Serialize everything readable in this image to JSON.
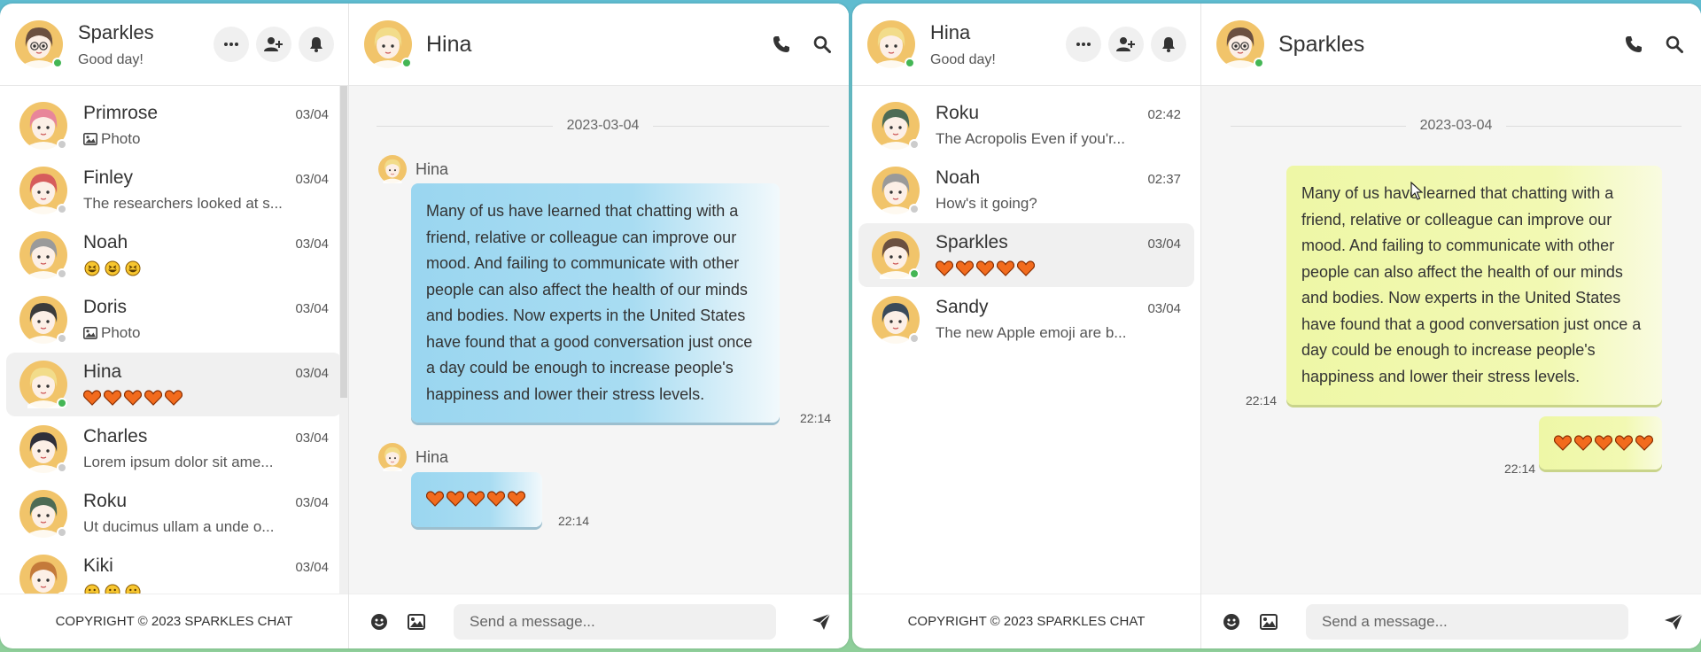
{
  "left": {
    "me": {
      "name": "Sparkles",
      "status": "Good day!"
    },
    "contacts": [
      {
        "name": "Primrose",
        "date": "03/04",
        "preview": "Photo",
        "kind": "photo",
        "hair": "#e8869a",
        "online": false
      },
      {
        "name": "Finley",
        "date": "03/04",
        "preview": "The researchers looked at s...",
        "kind": "text",
        "hair": "#d65c5c",
        "online": false
      },
      {
        "name": "Noah",
        "date": "03/04",
        "preview": "",
        "kind": "grins",
        "hair": "#9a9a9a",
        "online": false
      },
      {
        "name": "Doris",
        "date": "03/04",
        "preview": "Photo",
        "kind": "photo",
        "hair": "#3b3b3b",
        "online": false
      },
      {
        "name": "Hina",
        "date": "03/04",
        "preview": "",
        "kind": "hearts",
        "hair": "#f2dc8a",
        "online": true,
        "active": true
      },
      {
        "name": "Charles",
        "date": "03/04",
        "preview": "Lorem ipsum dolor sit ame...",
        "kind": "text",
        "hair": "#2f2f3a",
        "online": false
      },
      {
        "name": "Roku",
        "date": "03/04",
        "preview": "Ut ducimus ullam a unde o...",
        "kind": "text",
        "hair": "#4d6b55",
        "online": false
      },
      {
        "name": "Kiki",
        "date": "03/04",
        "preview": "",
        "kind": "smiles",
        "hair": "#c47a3a",
        "online": false
      }
    ],
    "footer": "COPYRIGHT © 2023 SPARKLES CHAT",
    "chat": {
      "name": "Hina",
      "date": "2023-03-04",
      "sender1": "Hina",
      "message1": "Many of us have learned that chatting with a friend, relative or colleague can improve our mood. And failing to communicate with other people can also affect the health of our minds and bodies. Now experts in the United States have found that a good conversation just once a day could be enough to increase people's happiness and lower their stress levels.",
      "time1": "22:14",
      "sender2": "Hina",
      "time2": "22:14",
      "placeholder": "Send a message..."
    }
  },
  "right": {
    "me": {
      "name": "Hina",
      "status": "Good day!"
    },
    "contacts": [
      {
        "name": "Roku",
        "date": "02:42",
        "preview": "The Acropolis Even if you'r...",
        "kind": "text",
        "hair": "#4d6b55",
        "online": false
      },
      {
        "name": "Noah",
        "date": "02:37",
        "preview": "How's it going?",
        "kind": "text",
        "hair": "#9a9a9a",
        "online": false
      },
      {
        "name": "Sparkles",
        "date": "03/04",
        "preview": "",
        "kind": "hearts",
        "hair": "#6b5040",
        "online": true,
        "active": true
      },
      {
        "name": "Sandy",
        "date": "03/04",
        "preview": "The new Apple emoji are b...",
        "kind": "text",
        "hair": "#3a4a5a",
        "online": false
      }
    ],
    "footer": "COPYRIGHT © 2023 SPARKLES CHAT",
    "chat": {
      "name": "Sparkles",
      "date": "2023-03-04",
      "message1": "Many of us have learned that chatting with a friend, relative or colleague can improve our mood. And failing to communicate with other people can also affect the health of our minds and bodies. Now experts in the United States have found that a good conversation just once a day could be enough to increase people's happiness and lower their stress levels.",
      "time1": "22:14",
      "time2": "22:14",
      "placeholder": "Send a message..."
    }
  },
  "colors": {
    "online": "#44b655",
    "bubble_blue": "#9ad6f0",
    "bubble_yellow": "#eef7a6",
    "heart": "#f26b1d"
  }
}
